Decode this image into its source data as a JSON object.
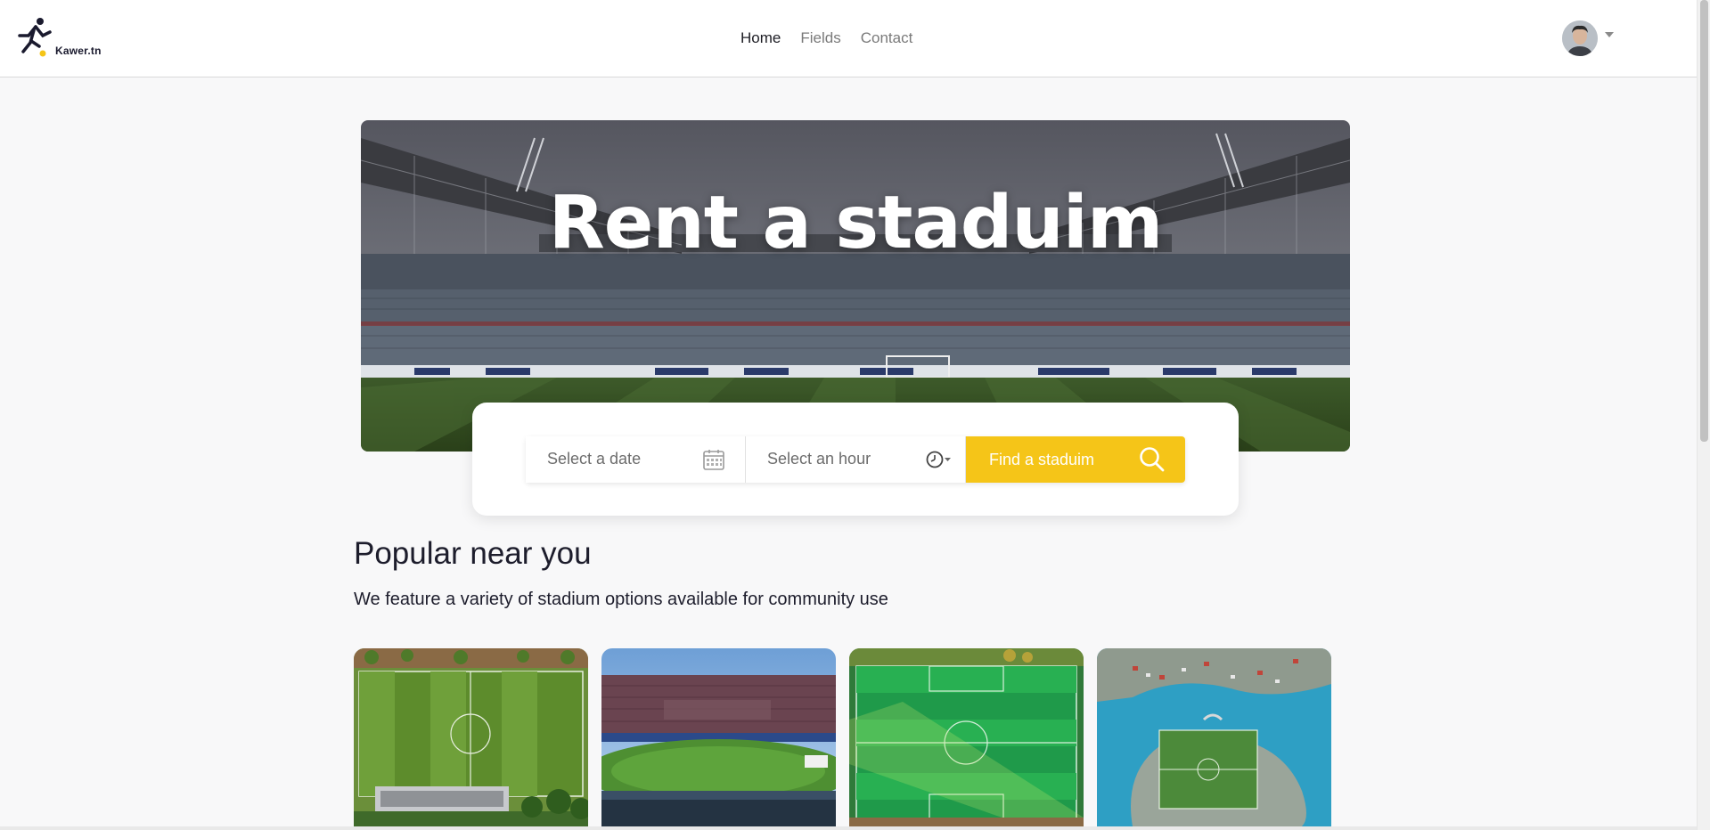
{
  "brand": {
    "name": "Kawer.tn",
    "logo_icon": "runner-icon"
  },
  "nav": {
    "links": [
      {
        "label": "Home",
        "active": true
      },
      {
        "label": "Fields",
        "active": false
      },
      {
        "label": "Contact",
        "active": false
      }
    ],
    "user": {
      "avatar_icon": "user-avatar",
      "menu_icon": "caret-down-icon"
    }
  },
  "hero": {
    "title": "Rent a staduim"
  },
  "search": {
    "date_placeholder": "Select a date",
    "date_icon": "calendar-icon",
    "hour_placeholder": "Select an hour",
    "hour_icon": "clock-icon",
    "button_label": "Find a staduim",
    "button_icon": "search-icon",
    "accent_color": "#f5c518"
  },
  "popular": {
    "title": "Popular near you",
    "subtitle": "We feature a variety of stadium options available for community use",
    "cards": [
      {
        "image": "aerial-field-trees"
      },
      {
        "image": "stadium-stands"
      },
      {
        "image": "aerial-green-pitch"
      },
      {
        "image": "coastal-island-pitch"
      }
    ]
  }
}
